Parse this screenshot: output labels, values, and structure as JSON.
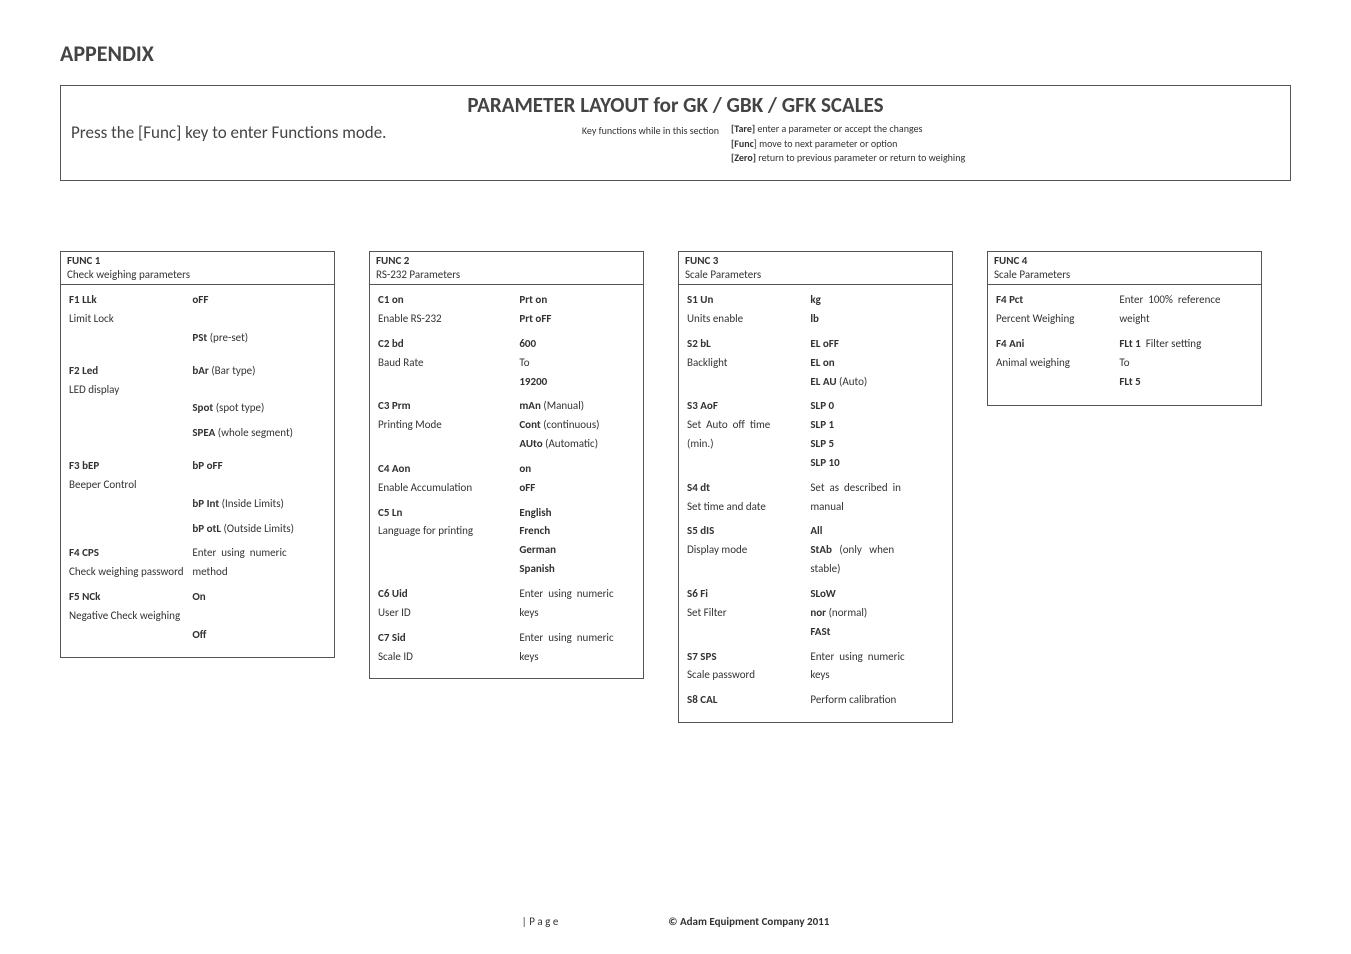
{
  "appendix": "APPENDIX",
  "banner": {
    "title": "PARAMETER  LAYOUT for  GK / GBK / GFK SCALES",
    "press_line": "Press  the  [Func]  key  to enter Functions mode.",
    "keyfn_label": "Key functions while in this section",
    "hint_tare": "[Tare] enter a parameter or accept the changes",
    "hint_func": "[Func] move to next parameter or option",
    "hint_zero": "[Zero] return to previous parameter or return to weighing"
  },
  "func1": {
    "head": "FUNC 1",
    "sub": "Check weighing parameters",
    "f1_label": "F1 LLk",
    "f1_desc": "Limit Lock",
    "f1_off": "oFF",
    "f1_pst": "PSt (pre-set)",
    "f2_label": "F2 Led",
    "f2_desc": "LED display",
    "f2_bar": "bAr (Bar type)",
    "f2_spot": "Spot (spot type)",
    "f2_spea": "SPEA (whole segment)",
    "f3_label": "F3 bEP",
    "f3_desc": "Beeper Control",
    "f3_bpoff": "bP oFF",
    "f3_bpint": "bP Int (Inside Limits)",
    "f3_bpotl": "bP otL (Outside Limits)",
    "f4_label": "F4 CPS",
    "f4_desc": "Check weighing password",
    "f4_val": "Enter using numeric method",
    "f5_label": "F5 NCk",
    "f5_desc": "Negative Check weighing",
    "f5_on": "On",
    "f5_off": "Off"
  },
  "func2": {
    "head": "FUNC 2",
    "sub": "RS-232 Parameters",
    "c1_label": "C1 on",
    "c1_desc": "Enable RS-232",
    "c1_on": "Prt on",
    "c1_off": "Prt oFF",
    "c2_label": "C2 bd",
    "c2_desc": "Baud Rate",
    "c2_600": "600",
    "c2_to": "To",
    "c2_19200": "19200",
    "c3_label": "C3 Prm",
    "c3_desc": "Printing Mode",
    "c3_man": "mAn (Manual)",
    "c3_cont": "Cont (continuous)",
    "c3_auto": "AUto (Automatic)",
    "c4_label": "C4 Aon",
    "c4_desc": "Enable Accumulation",
    "c4_on": "on",
    "c4_off": "oFF",
    "c5_label": "C5 Ln",
    "c5_desc": "Language for printing",
    "c5_en": "English",
    "c5_fr": "French",
    "c5_de": "German",
    "c5_es": "Spanish",
    "c6_label": "C6 Uid",
    "c6_desc": "User ID",
    "c6_val": "Enter using numeric keys",
    "c7_label": "C7 Sid",
    "c7_desc": "Scale ID",
    "c7_val": "Enter using numeric keys"
  },
  "func3": {
    "head": "FUNC 3",
    "sub": "Scale Parameters",
    "s1_label": "S1 Un",
    "s1_desc": "Units enable",
    "s1_kg": "kg",
    "s1_lb": "lb",
    "s2_label": "S2 bL",
    "s2_desc": "Backlight",
    "s2_off": "EL oFF",
    "s2_on": "EL on",
    "s2_auto": "EL AU (Auto)",
    "s3_label": "S3 AoF",
    "s3_desc": "Set Auto off time (min.)",
    "s3_slp0": "SLP 0",
    "s3_slp1": "SLP 1",
    "s3_slp5": "SLP 5",
    "s3_slp10": "SLP 10",
    "s4_label": "S4 dt",
    "s4_desc": "Set time and date",
    "s4_val": "Set as described in manual",
    "s5_label": "S5 dIS",
    "s5_desc": "Display mode",
    "s5_all": "All",
    "s5_stab": "StAb (only when stable)",
    "s6_label": "S6 Fi",
    "s6_desc": "Set Filter",
    "s6_slow": "SLoW",
    "s6_nor": "nor (normal)",
    "s6_fast": "FASt",
    "s7_label": "S7 SPS",
    "s7_desc": "Scale password",
    "s7_val": "Enter using numeric keys",
    "s8_label": "S8 CAL",
    "s8_val": "Perform calibration"
  },
  "func4": {
    "head": "FUNC 4",
    "sub": "Scale Parameters",
    "f4_label": "F4 Pct",
    "f4_desc": "Percent Weighing",
    "f4_val": "Enter 100% reference weight",
    "f4a_label": "F4 Ani",
    "f4a_desc": "Animal weighing",
    "f4a_flt1": "FLt 1  Filter setting",
    "f4a_to": "To",
    "f4a_flt5": "FLt 5"
  },
  "footer": {
    "page": "| P a g e",
    "copyright": "© Adam Equipment Company 2011"
  }
}
